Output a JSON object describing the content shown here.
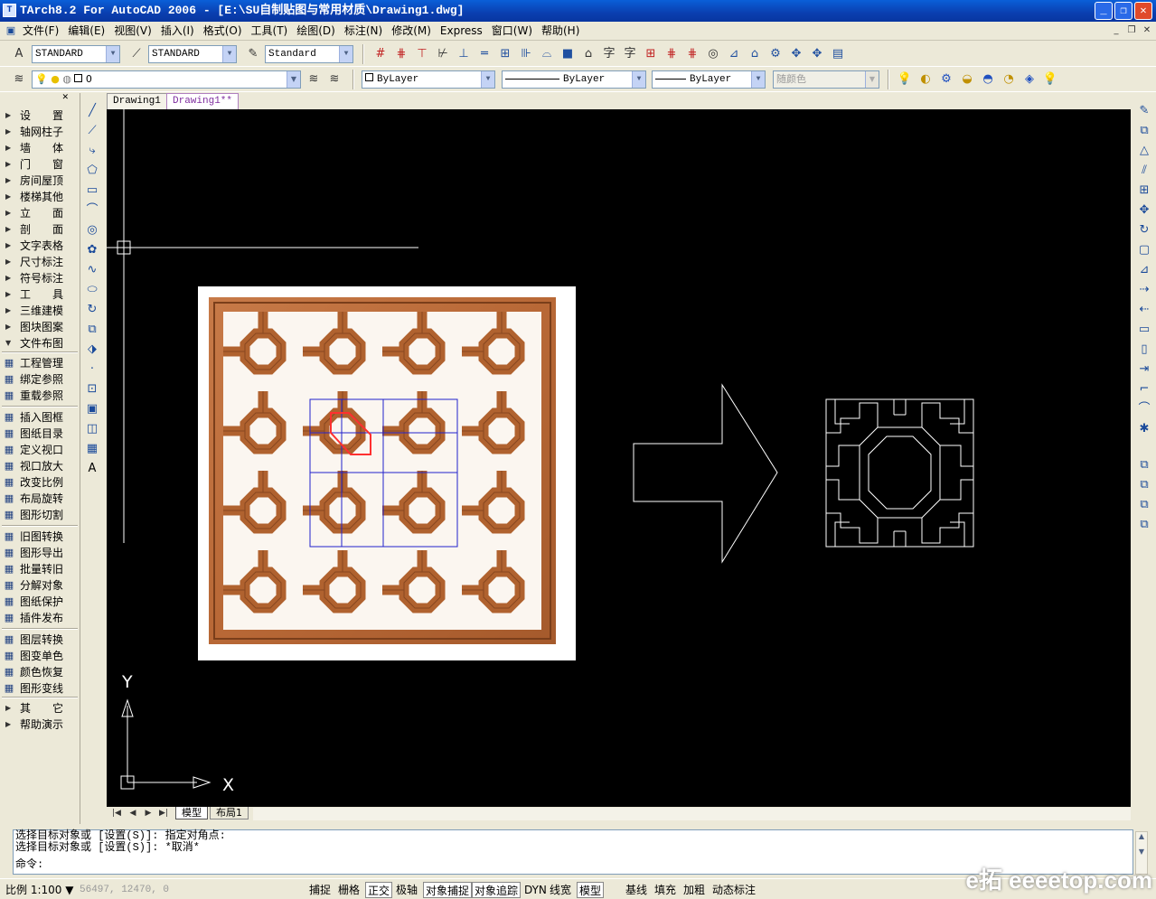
{
  "title": "TArch8.2 For AutoCAD 2006 - [E:\\SU自制贴图与常用材质\\Drawing1.dwg]",
  "menu": [
    "文件(F)",
    "编辑(E)",
    "视图(V)",
    "插入(I)",
    "格式(O)",
    "工具(T)",
    "绘图(D)",
    "标注(N)",
    "修改(M)",
    "Express",
    "窗口(W)",
    "帮助(H)"
  ],
  "toolbar1": {
    "textstyle": "STANDARD",
    "dimstyle": "STANDARD",
    "tablestyle": "Standard"
  },
  "toolbar2": {
    "layer": "0",
    "color": "ByLayer",
    "linetype": "ByLayer",
    "lineweight": "ByLayer",
    "plotstyle": "随颜色"
  },
  "tabs": [
    "Drawing1",
    "Drawing1**"
  ],
  "sidebar": {
    "groups": [
      "设　　置",
      "轴网柱子",
      "墙　　体",
      "门　　窗",
      "房间屋顶",
      "楼梯其他",
      "立　　面",
      "剖　　面",
      "文字表格",
      "尺寸标注",
      "符号标注",
      "工　　具",
      "三维建模",
      "图块图案",
      "文件布图"
    ],
    "tools": [
      "工程管理",
      "绑定参照",
      "重载参照",
      "插入图框",
      "图纸目录",
      "定义视口",
      "视口放大",
      "改变比例",
      "布局旋转",
      "图形切割",
      "旧图转换",
      "图形导出",
      "批量转旧",
      "分解对象",
      "图纸保护",
      "插件发布",
      "图层转换",
      "图变单色",
      "颜色恢复",
      "图形变线"
    ],
    "tail": [
      "其　　它",
      "帮助演示"
    ]
  },
  "canvas": {
    "axis_x": "X",
    "axis_y": "Y"
  },
  "layout_tabs": [
    "模型",
    "布局1"
  ],
  "command": {
    "lines": [
      "选择目标对象或 [设置(S)]: 指定对角点:",
      "选择目标对象或 [设置(S)]: *取消*"
    ],
    "prompt": "命令:"
  },
  "status": {
    "scale": "比例 1:100 ▼",
    "coords": "56497, 12470, 0",
    "toggles": [
      "捕捉",
      "栅格",
      "正交",
      "极轴",
      "对象捕捉",
      "对象追踪",
      "DYN",
      "线宽",
      "模型"
    ],
    "toggles_on": [
      "正交",
      "对象捕捉",
      "对象追踪",
      "模型"
    ],
    "right": [
      "基线",
      "填充",
      "加粗",
      "动态标注"
    ]
  },
  "watermark": "e拓 eeeetop.com"
}
